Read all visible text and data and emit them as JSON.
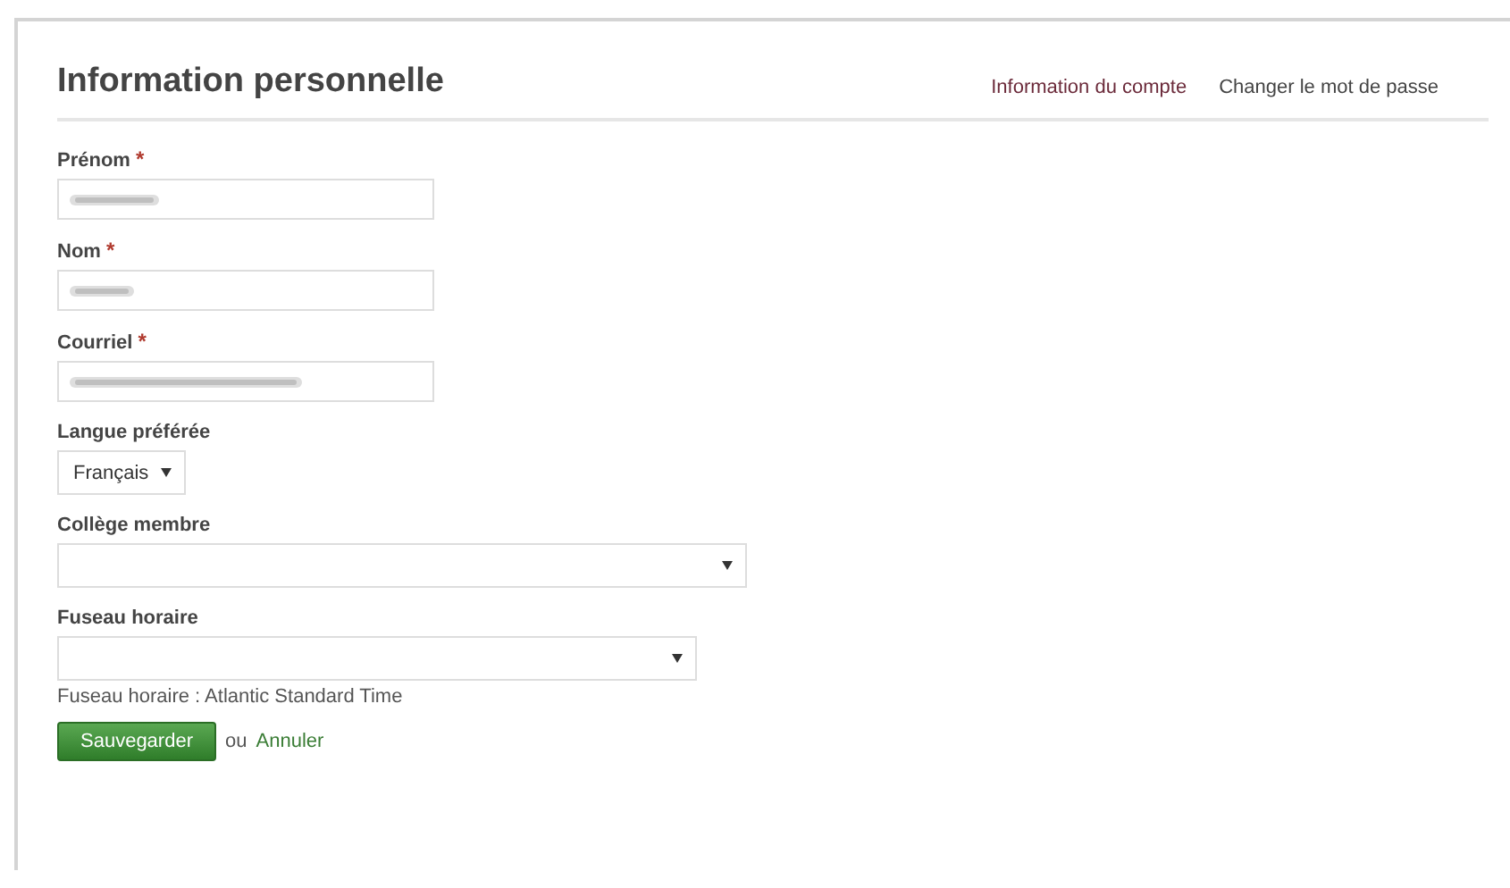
{
  "header": {
    "title": "Information personnelle"
  },
  "tabs": [
    {
      "label": "Information du compte",
      "selected": true
    },
    {
      "label": "Changer le mot de passe",
      "selected": false
    }
  ],
  "fields": [
    {
      "kind": "blurred",
      "label": "Prénom",
      "mark": "*"
    },
    {
      "kind": "blurred",
      "label": "Nom",
      "mark": "*"
    },
    {
      "kind": "blurred",
      "label": "Courriel",
      "mark": "*"
    },
    {
      "kind": "select",
      "label": "Langue préférée",
      "value": "Français"
    },
    {
      "kind": "select",
      "label": "Collège membre"
    },
    {
      "kind": "select",
      "label": "Fuseau horaire",
      "help": "Fuseau horaire : Atlantic Standard Time"
    }
  ],
  "actions": {
    "save": "Sauvegarder",
    "or": "ou",
    "cancel": "Annuler"
  }
}
